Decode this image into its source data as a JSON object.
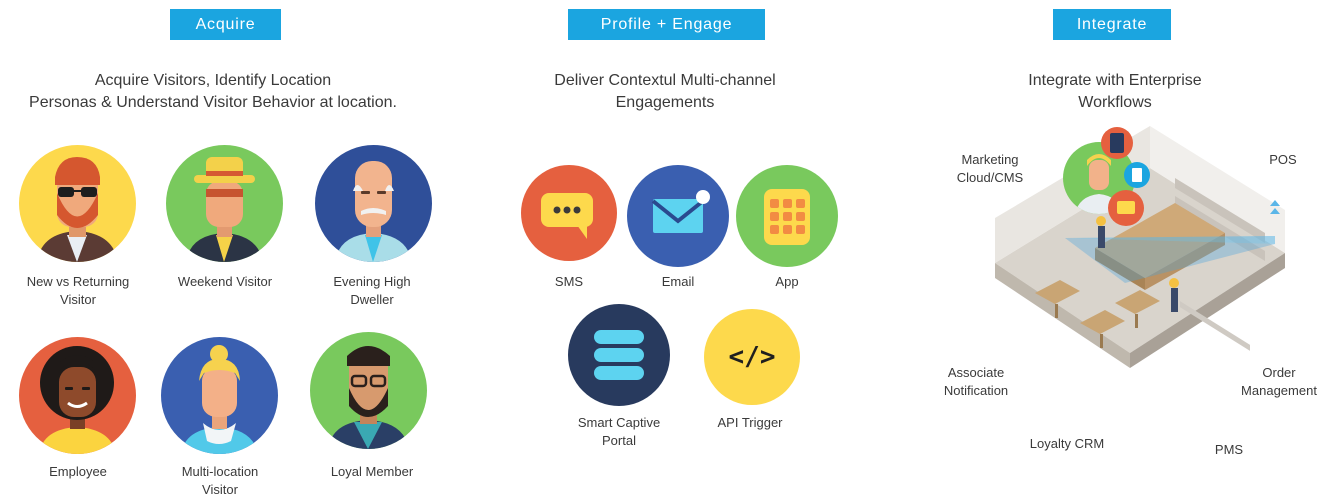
{
  "columns": {
    "acquire": {
      "tag": "Acquire",
      "heading_line1": "Acquire Visitors, Identify Location",
      "heading_line2": "Personas & Understand Visitor Behavior at location.",
      "personas": [
        {
          "line1": "New vs Returning",
          "line2": "Visitor"
        },
        {
          "line1": "Weekend Visitor",
          "line2": ""
        },
        {
          "line1": "Evening High",
          "line2": "Dweller"
        },
        {
          "line1": "Employee",
          "line2": ""
        },
        {
          "line1": "Multi-location",
          "line2": "Visitor"
        },
        {
          "line1": "Loyal Member",
          "line2": ""
        }
      ]
    },
    "engage": {
      "tag": "Profile + Engage",
      "heading_line1": "Deliver Contextul Multi-channel",
      "heading_line2": "Engagements",
      "channels": [
        {
          "line1": "SMS",
          "line2": ""
        },
        {
          "line1": "Email",
          "line2": ""
        },
        {
          "line1": "App",
          "line2": ""
        },
        {
          "line1": "Smart Captive",
          "line2": "Portal"
        },
        {
          "line1": "API Trigger",
          "line2": ""
        }
      ],
      "api_glyph": "</>"
    },
    "integrate": {
      "tag": "Integrate",
      "heading_line1": "Integrate with Enterprise",
      "heading_line2": "Workflows",
      "labels": {
        "marketing_line1": "Marketing",
        "marketing_line2": "Cloud/CMS",
        "pos": "POS",
        "associate_line1": "Associate",
        "associate_line2": "Notification",
        "order_line1": "Order",
        "order_line2": "Management",
        "loyalty": "Loyalty CRM",
        "pms": "PMS"
      }
    }
  },
  "colors": {
    "tag_blue": "#1ba5e0",
    "yellow": "#fdd94c",
    "green": "#79c95d",
    "navy": "#2f4f99",
    "red": "#e5603f",
    "blue": "#3a5fb0",
    "dark_navy": "#283a5e",
    "cyan": "#5dd3f0"
  }
}
